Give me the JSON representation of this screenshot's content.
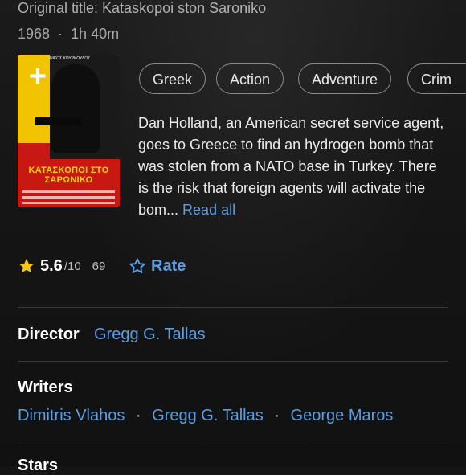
{
  "header": {
    "original_title": "Original title: Kataskopoi ston Saroniko",
    "year": "1968",
    "dot": "·",
    "runtime": "1h 40m"
  },
  "poster": {
    "add_icon": "plus-icon",
    "poster_title": "ΚΑΤΑΣΚΟΠΟΙ ΣΤΟ ΣΑΡΩΝΙΚΟ",
    "poster_top": "ΝΙΚΟΣ ΚΟΥΡΚΟΥΛΟΣ"
  },
  "genres": [
    "Greek",
    "Action",
    "Adventure",
    "Crim"
  ],
  "plot": {
    "text": "Dan Holland, an American secret service agent, goes to Greece to find an hydrogen bomb that was stolen from a NATO base in Turkey. There is the risk that foreign agents will activate the bom...",
    "read_all": "Read all"
  },
  "rating": {
    "icon": "star-icon",
    "score": "5.6",
    "out_of": "/10",
    "count": "69",
    "rate_icon": "star-outline-icon",
    "rate_label": "Rate",
    "star_color": "#f5c518"
  },
  "credits": {
    "director_label": "Director",
    "director": "Gregg G. Tallas",
    "writers_label": "Writers",
    "writers": [
      "Dimitris Vlahos",
      "Gregg G. Tallas",
      "George Maros"
    ],
    "separator": "·",
    "stars_label": "Stars"
  },
  "colors": {
    "link": "#5b9ee5",
    "background": "#141414"
  }
}
